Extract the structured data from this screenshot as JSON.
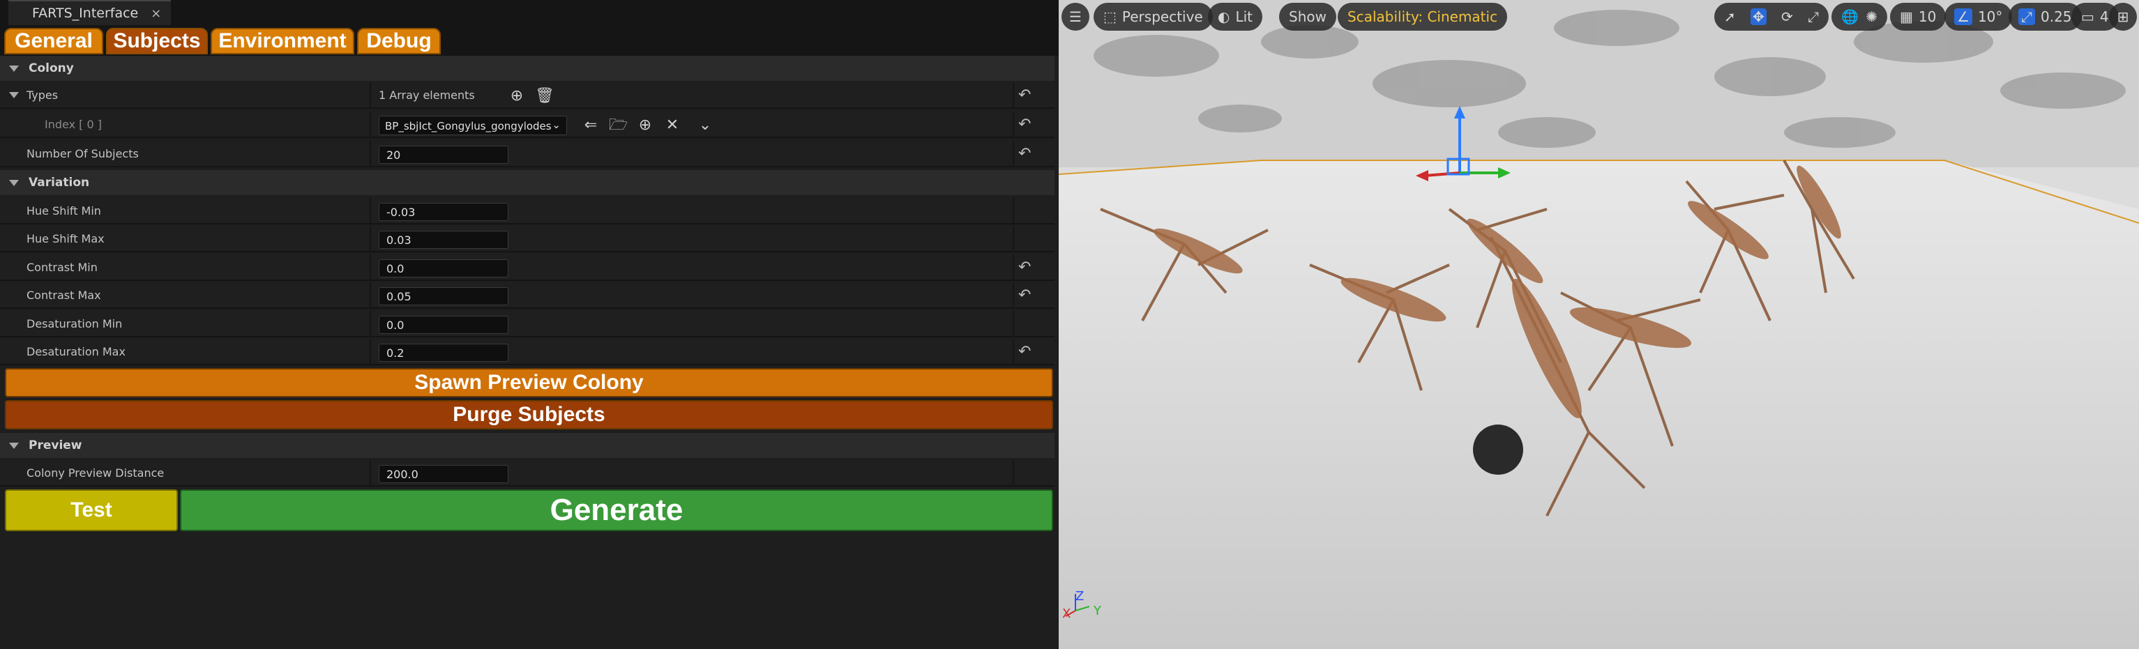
{
  "window": {
    "tab_title": "FARTS_Interface",
    "close_glyph": "×"
  },
  "main_tabs": [
    "General",
    "Subjects",
    "Environment",
    "Debug"
  ],
  "colony": {
    "section": "Colony",
    "types_label": "Types",
    "types_value": "1 Array elements",
    "index_label": "Index [ 0 ]",
    "index_value": "BP_sbjIct_Gongylus_gongylodes",
    "subjects_label": "Number Of Subjects",
    "subjects_value": "20"
  },
  "variation": {
    "section": "Variation",
    "rows": [
      {
        "label": "Hue Shift Min",
        "value": "-0.03"
      },
      {
        "label": "Hue Shift Max",
        "value": "0.03"
      },
      {
        "label": "Contrast Min",
        "value": "0.0"
      },
      {
        "label": "Contrast Max",
        "value": "0.05"
      },
      {
        "label": "Desaturation Min",
        "value": "0.0"
      },
      {
        "label": "Desaturation Max",
        "value": "0.2"
      }
    ]
  },
  "buttons": {
    "spawn": "Spawn Preview Colony",
    "purge": "Purge Subjects",
    "test": "Test",
    "generate": "Generate"
  },
  "preview": {
    "section": "Preview",
    "distance_label": "Colony Preview Distance",
    "distance_value": "200.0"
  },
  "viewport": {
    "perspective": "Perspective",
    "lit": "Lit",
    "show": "Show",
    "scalability": "Scalability: Cinematic",
    "grid_snap": "10",
    "rotation_snap": "10°",
    "scale_snap": "0.25",
    "camera_speed": "4",
    "axis_x": "X",
    "axis_y": "Y",
    "axis_z": "Z"
  },
  "colors": {
    "orange_tab": "#d97f08",
    "spawn_button": "#d07208",
    "purge_button": "#9a3c06",
    "test_button": "#c2b600",
    "generate_button": "#3a9a3a",
    "scalability_text": "#f2c23a"
  }
}
